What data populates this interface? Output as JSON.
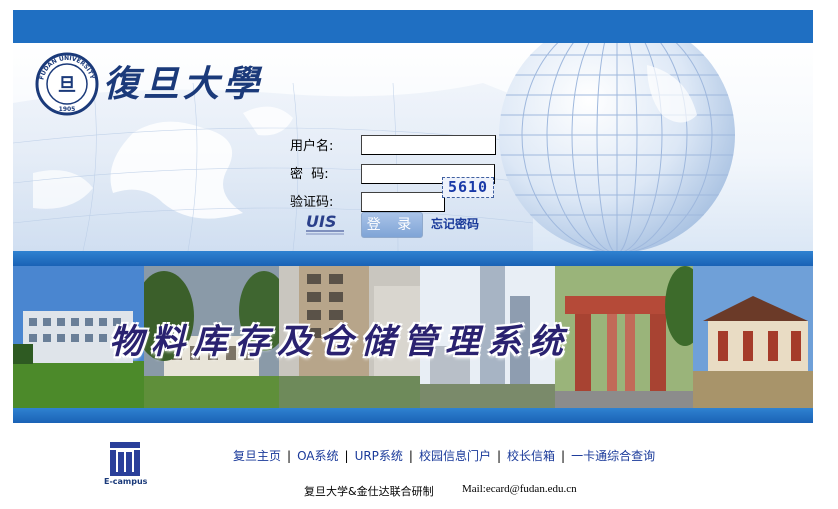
{
  "header": {
    "university_name": "復旦大學",
    "logo_text": "FUDAN UNIVERSITY 1905"
  },
  "login": {
    "username_label": "用户名:",
    "password_label": "密  码:",
    "captcha_label": "验证码:",
    "username_value": "",
    "password_value": "",
    "captcha_value": "",
    "captcha_code": "5610",
    "uis_logo_text": "UIS",
    "login_button": "登 录",
    "forgot_password": "忘记密码"
  },
  "banner": {
    "title": "物料库存及仓储管理系统"
  },
  "footer": {
    "ecampus_label": "E-campus",
    "links": [
      "复旦主页",
      "OA系统",
      "URP系统",
      "校园信息门户",
      "校长信箱",
      "一卡通综合查询"
    ],
    "credit": "复旦大学&金仕达联合研制",
    "mail": "Mail:ecard@fudan.edu.cn"
  },
  "colors": {
    "primary_blue": "#1f6fc2",
    "link_blue": "#1a3a9a",
    "banner_title": "#2a2270"
  }
}
